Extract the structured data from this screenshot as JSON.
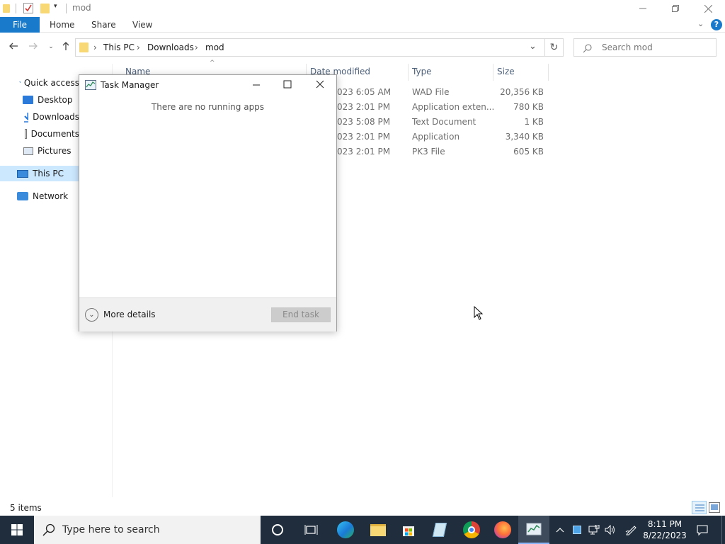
{
  "explorer": {
    "window_title": "mod",
    "ribbon_tabs": [
      "File",
      "Home",
      "Share",
      "View"
    ],
    "breadcrumb": [
      "This PC",
      "Downloads",
      "mod"
    ],
    "search_placeholder": "Search mod",
    "sidebar": [
      {
        "label": "Quick access"
      },
      {
        "label": "Desktop"
      },
      {
        "label": "Downloads"
      },
      {
        "label": "Documents"
      },
      {
        "label": "Pictures"
      },
      {
        "label": "This PC"
      },
      {
        "label": "Network"
      }
    ],
    "columns": {
      "name": "Name",
      "date": "Date modified",
      "type": "Type",
      "size": "Size"
    },
    "rows": [
      {
        "date": "023 6:05 AM",
        "type": "WAD File",
        "size": "20,356 KB"
      },
      {
        "date": "023 2:01 PM",
        "type": "Application exten...",
        "size": "780 KB"
      },
      {
        "date": "023 5:08 PM",
        "type": "Text Document",
        "size": "1 KB"
      },
      {
        "date": "023 2:01 PM",
        "type": "Application",
        "size": "3,340 KB"
      },
      {
        "date": "023 2:01 PM",
        "type": "PK3 File",
        "size": "605 KB"
      }
    ],
    "status": "5 items"
  },
  "taskmgr": {
    "title": "Task Manager",
    "empty_message": "There are no running apps",
    "more_details": "More details",
    "end_task": "End task"
  },
  "taskbar": {
    "search_placeholder": "Type here to search",
    "time": "8:11 PM",
    "date": "8/22/2023"
  },
  "colors": {
    "accent": "#1979ca",
    "taskbar": "#1f2d3d",
    "selection": "#cce8ff",
    "folder": "#f8d775"
  }
}
